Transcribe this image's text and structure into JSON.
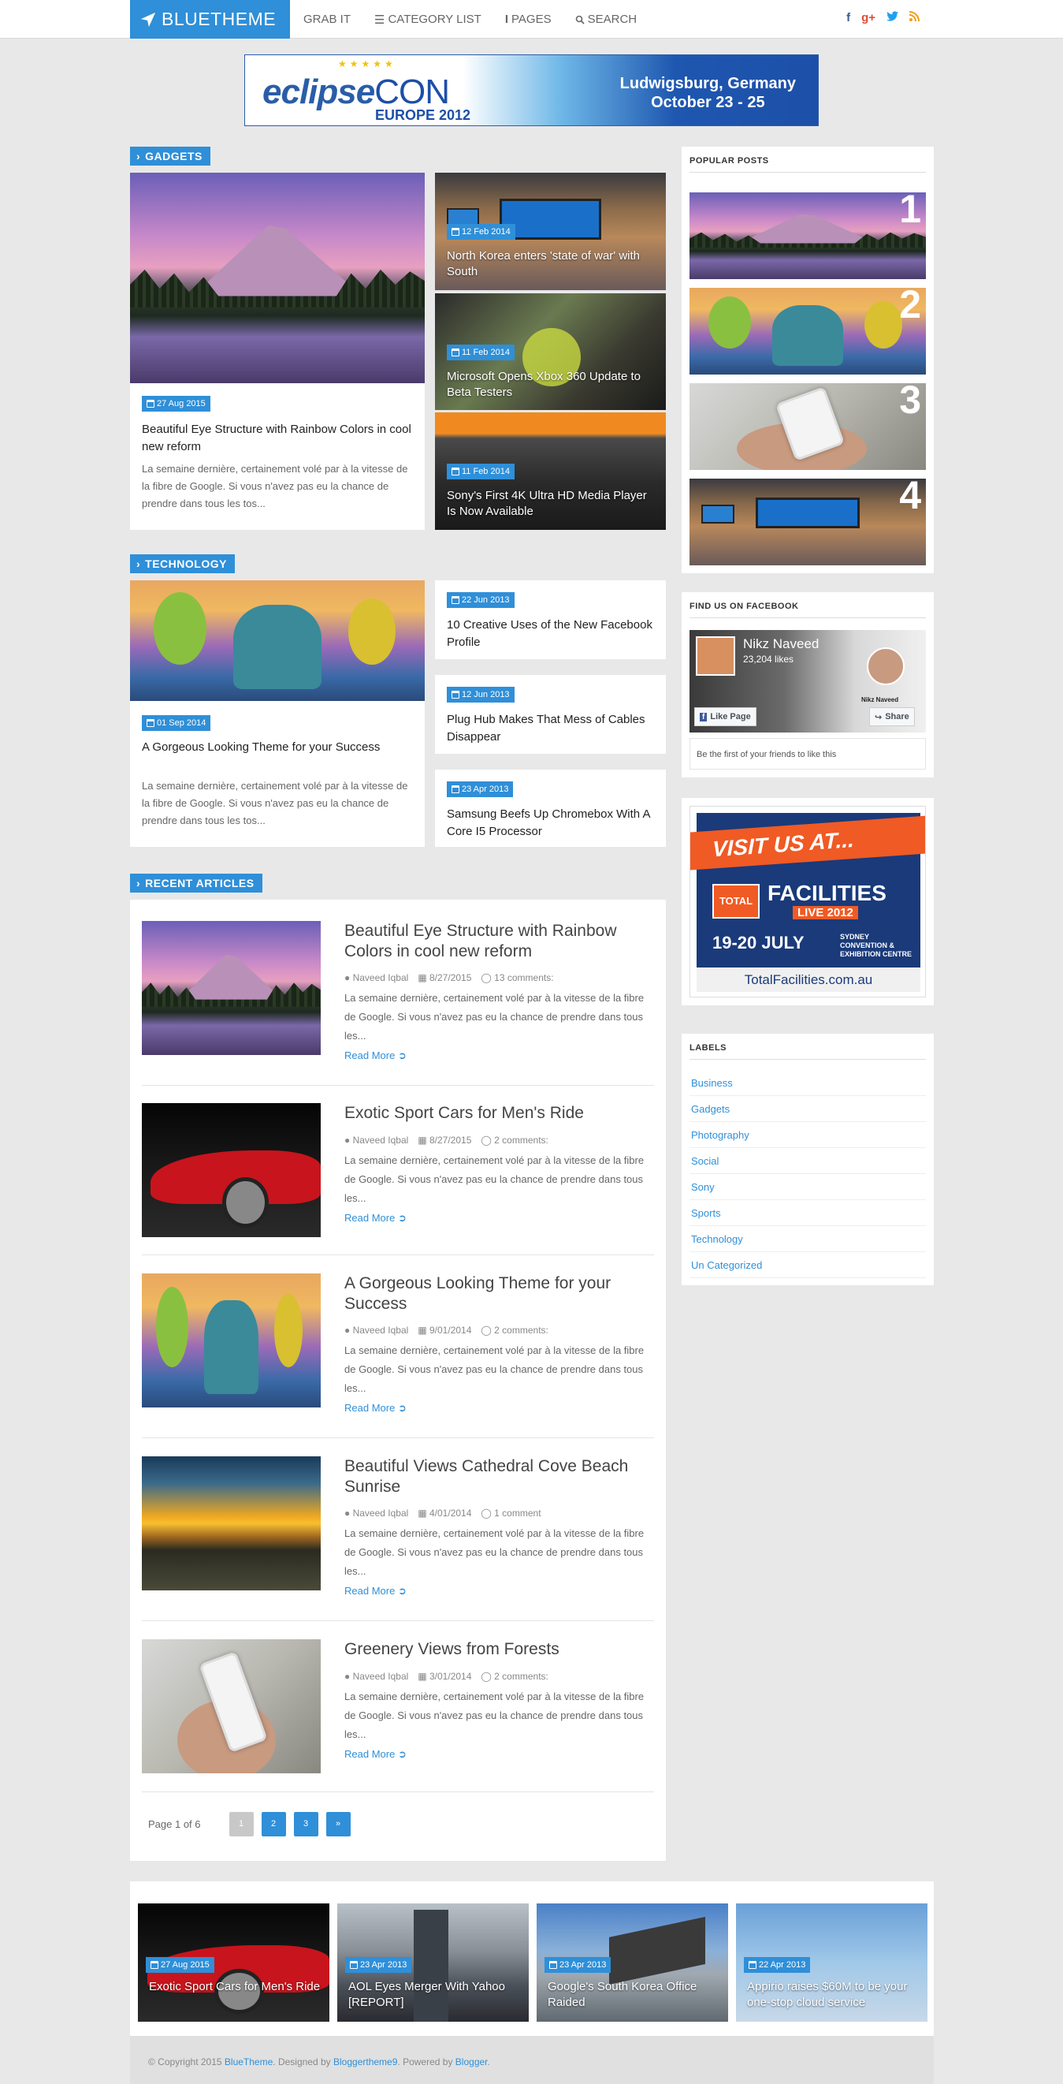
{
  "nav": {
    "brand": "BLUETHEME",
    "items": [
      "GRAB IT",
      "CATEGORY LIST",
      "PAGES",
      "SEARCH"
    ],
    "social": [
      "f",
      "g+",
      "t",
      "rss"
    ]
  },
  "banner": {
    "logo": "eclipse",
    "logo_con": "CON",
    "europe": "EUROPE 2012",
    "place_line1": "Ludwigsburg, Germany",
    "place_line2": "October 23 - 25"
  },
  "gadgets": {
    "label": "GADGETS",
    "main": {
      "date": "27 Aug 2015",
      "title": "Beautiful Eye Structure with Rainbow Colors in cool new reform",
      "excerpt": "La semaine dernière, certainement volé par à la vitesse de la fibre de Google. Si vous n'avez pas eu la chance de prendre dans tous les tos..."
    },
    "side": [
      {
        "date": "12 Feb 2014",
        "title": "North Korea enters 'state of war' with South"
      },
      {
        "date": "11 Feb 2014",
        "title": "Microsoft Opens Xbox 360 Update to Beta Testers"
      },
      {
        "date": "11 Feb 2014",
        "title": "Sony's First 4K Ultra HD Media Player Is Now Available"
      }
    ]
  },
  "technology": {
    "label": "TECHNOLOGY",
    "main": {
      "date": "01 Sep 2014",
      "title": "A Gorgeous Looking Theme for your Success",
      "excerpt": "La semaine dernière, certainement volé par à la vitesse de la fibre de Google. Si vous n'avez pas eu la chance de prendre dans tous les tos..."
    },
    "side": [
      {
        "date": "22 Jun 2013",
        "title": "10 Creative Uses of the New Facebook Profile"
      },
      {
        "date": "12 Jun 2013",
        "title": "Plug Hub Makes That Mess of Cables Disappear"
      },
      {
        "date": "23 Apr 2013",
        "title": "Samsung Beefs Up Chromebox With A Core I5 Processor"
      }
    ]
  },
  "recent": {
    "label": "RECENT ARTICLES",
    "items": [
      {
        "title": "Beautiful Eye Structure with Rainbow Colors in cool new reform",
        "author": "Naveed Iqbal",
        "date": "8/27/2015",
        "comments": "13 comments:",
        "excerpt": "La semaine dernière, certainement volé par à la vitesse de la fibre de Google. Si vous n'avez pas eu la chance de prendre dans tous les...",
        "more": "Read More"
      },
      {
        "title": "Exotic Sport Cars for Men's Ride",
        "author": "Naveed Iqbal",
        "date": "8/27/2015",
        "comments": "2 comments:",
        "excerpt": "La semaine dernière, certainement volé par à la vitesse de la fibre de Google. Si vous n'avez pas eu la chance de prendre dans tous les...",
        "more": "Read More"
      },
      {
        "title": "A Gorgeous Looking Theme for your Success",
        "author": "Naveed Iqbal",
        "date": "9/01/2014",
        "comments": "2 comments:",
        "excerpt": "La semaine dernière, certainement volé par à la vitesse de la fibre de Google. Si vous n'avez pas eu la chance de prendre dans tous les...",
        "more": "Read More"
      },
      {
        "title": "Beautiful Views Cathedral Cove Beach Sunrise",
        "author": "Naveed Iqbal",
        "date": "4/01/2014",
        "comments": "1 comment",
        "excerpt": "La semaine dernière, certainement volé par à la vitesse de la fibre de Google. Si vous n'avez pas eu la chance de prendre dans tous les...",
        "more": "Read More"
      },
      {
        "title": "Greenery Views from Forests",
        "author": "Naveed Iqbal",
        "date": "3/01/2014",
        "comments": "2 comments:",
        "excerpt": "La semaine dernière, certainement volé par à la vitesse de la fibre de Google. Si vous n'avez pas eu la chance de prendre dans tous les...",
        "more": "Read More"
      }
    ],
    "page_info": "Page 1 of 6",
    "pages": [
      "1",
      "2",
      "3",
      "»"
    ]
  },
  "sidebar": {
    "popular_title": "POPULAR POSTS",
    "popular_nums": [
      "1",
      "2",
      "3",
      "4"
    ],
    "facebook_title": "FIND US ON FACEBOOK",
    "fb_name": "Nikz Naveed",
    "fb_likes": "23,204 likes",
    "fb_like_btn": "Like Page",
    "fb_share_btn": "Share",
    "fb_caption": "Nikz Naveed",
    "fb_friends": "Be the first of your friends to like this",
    "ad_visit": "VISIT US AT...",
    "ad_total": "TOTAL",
    "ad_facilities": "FACILITIES",
    "ad_live": "LIVE 2012",
    "ad_dates": "19-20 JULY",
    "ad_venue": "SYDNEY CONVENTION & EXHIBITION CENTRE",
    "ad_url": "TotalFacilities.com.au",
    "labels_title": "LABELS",
    "labels": [
      "Business",
      "Gadgets",
      "Photography",
      "Social",
      "Sony",
      "Sports",
      "Technology",
      "Un Categorized"
    ]
  },
  "bottom": {
    "items": [
      {
        "date": "27 Aug 2015",
        "title": "Exotic Sport Cars for Men's Ride"
      },
      {
        "date": "23 Apr 2013",
        "title": "AOL Eyes Merger With Yahoo [REPORT]"
      },
      {
        "date": "23 Apr 2013",
        "title": "Google's South Korea Office Raided"
      },
      {
        "date": "22 Apr 2013",
        "title": "Appirio raises $60M to be your one-stop cloud service"
      }
    ]
  },
  "footer": {
    "prefix": "© Copyright 2015",
    "site": "BlueTheme",
    "designed": ". Designed by",
    "designer": "Bloggertheme9",
    "powered": ". Powered by",
    "platform": "Blogger",
    "end": "."
  }
}
